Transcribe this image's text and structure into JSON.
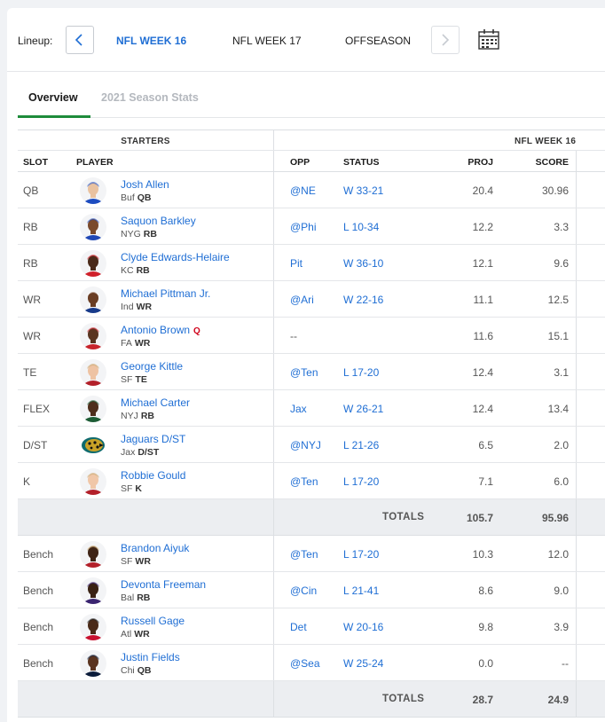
{
  "lineup": {
    "label": "Lineup:",
    "weeks": [
      {
        "label": "NFL WEEK 16",
        "active": true
      },
      {
        "label": "NFL WEEK 17",
        "active": false
      },
      {
        "label": "OFFSEASON",
        "active": false
      }
    ]
  },
  "tabs": {
    "overview": "Overview",
    "season_stats": "2021 Season Stats"
  },
  "table": {
    "section_label": "STARTERS",
    "week_label": "NFL WEEK 16",
    "headers": {
      "slot": "SLOT",
      "player": "PLAYER",
      "opp": "OPP",
      "status": "STATUS",
      "proj": "PROJ",
      "score": "SCORE"
    },
    "starters": [
      {
        "slot": "QB",
        "name": "Josh Allen",
        "team": "Buf",
        "pos": "QB",
        "injury": "",
        "opp": "@NE",
        "status": "W 33-21",
        "proj": "20.4",
        "score": "30.96",
        "jersey": "#1d4cc0",
        "skin": "#e9c2a0",
        "helmet": "#1d4cc0"
      },
      {
        "slot": "RB",
        "name": "Saquon Barkley",
        "team": "NYG",
        "pos": "RB",
        "injury": "",
        "opp": "@Phi",
        "status": "L 10-34",
        "proj": "12.2",
        "score": "3.3",
        "jersey": "#1f47b5",
        "skin": "#7a4a2c",
        "helmet": "#1f47b5"
      },
      {
        "slot": "RB",
        "name": "Clyde Edwards-Helaire",
        "team": "KC",
        "pos": "RB",
        "injury": "",
        "opp": "Pit",
        "status": "W 36-10",
        "proj": "12.1",
        "score": "9.6",
        "jersey": "#d0202a",
        "skin": "#4a2a1a",
        "helmet": "#d0202a"
      },
      {
        "slot": "WR",
        "name": "Michael Pittman Jr.",
        "team": "Ind",
        "pos": "WR",
        "injury": "",
        "opp": "@Ari",
        "status": "W 22-16",
        "proj": "11.1",
        "score": "12.5",
        "jersey": "#173a8a",
        "skin": "#6a3e24",
        "helmet": "#ffffff"
      },
      {
        "slot": "WR",
        "name": "Antonio Brown",
        "team": "FA",
        "pos": "WR",
        "injury": "Q",
        "opp": "--",
        "status": "",
        "proj": "11.6",
        "score": "15.1",
        "jersey": "#c8232b",
        "skin": "#5a3420",
        "helmet": "#c8232b"
      },
      {
        "slot": "TE",
        "name": "George Kittle",
        "team": "SF",
        "pos": "TE",
        "injury": "",
        "opp": "@Ten",
        "status": "L 17-20",
        "proj": "12.4",
        "score": "3.1",
        "jersey": "#b3202a",
        "skin": "#eec3a3",
        "helmet": "#c9a46a"
      },
      {
        "slot": "FLEX",
        "name": "Michael Carter",
        "team": "NYJ",
        "pos": "RB",
        "injury": "",
        "opp": "Jax",
        "status": "W 26-21",
        "proj": "12.4",
        "score": "13.4",
        "jersey": "#1d5c35",
        "skin": "#4e2e1c",
        "helmet": "#1d5c35"
      },
      {
        "slot": "D/ST",
        "name": "Jaguars D/ST",
        "team": "Jax",
        "pos": "D/ST",
        "injury": "",
        "opp": "@NYJ",
        "status": "L 21-26",
        "proj": "6.5",
        "score": "2.0",
        "jersey": "",
        "skin": "",
        "helmet": "",
        "logo": true
      },
      {
        "slot": "K",
        "name": "Robbie Gould",
        "team": "SF",
        "pos": "K",
        "injury": "",
        "opp": "@Ten",
        "status": "L 17-20",
        "proj": "7.1",
        "score": "6.0",
        "jersey": "#b3202a",
        "skin": "#f0c7a8",
        "helmet": "#c9a46a"
      }
    ],
    "starters_totals": {
      "label": "TOTALS",
      "proj": "105.7",
      "score": "95.96"
    },
    "bench": [
      {
        "slot": "Bench",
        "name": "Brandon Aiyuk",
        "team": "SF",
        "pos": "WR",
        "injury": "",
        "opp": "@Ten",
        "status": "L 17-20",
        "proj": "10.3",
        "score": "12.0",
        "jersey": "#b3202a",
        "skin": "#3e2416",
        "helmet": "#c9a46a"
      },
      {
        "slot": "Bench",
        "name": "Devonta Freeman",
        "team": "Bal",
        "pos": "RB",
        "injury": "",
        "opp": "@Cin",
        "status": "L 21-41",
        "proj": "8.6",
        "score": "9.0",
        "jersey": "#3a2470",
        "skin": "#3a2214",
        "helmet": "#3a2470"
      },
      {
        "slot": "Bench",
        "name": "Russell Gage",
        "team": "Atl",
        "pos": "WR",
        "injury": "",
        "opp": "Det",
        "status": "W 20-16",
        "proj": "9.8",
        "score": "3.9",
        "jersey": "#c8102e",
        "skin": "#4a2a18",
        "helmet": "#1b1b1b"
      },
      {
        "slot": "Bench",
        "name": "Justin Fields",
        "team": "Chi",
        "pos": "QB",
        "injury": "",
        "opp": "@Sea",
        "status": "W 25-24",
        "proj": "0.0",
        "score": "--",
        "jersey": "#0b1c3a",
        "skin": "#5a3420",
        "helmet": "#0b1c3a"
      }
    ],
    "bench_totals": {
      "label": "TOTALS",
      "proj": "28.7",
      "score": "24.9"
    }
  },
  "colors": {
    "link": "#1f6ed4",
    "active_tab": "#1e8c3b",
    "injury": "#d0021b"
  }
}
